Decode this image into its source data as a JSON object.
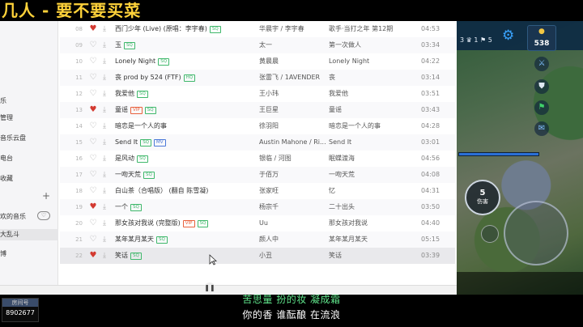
{
  "overlay": {
    "title": "几人 - 要不要买菜"
  },
  "sidebar": {
    "items": [
      {
        "label": "乐"
      },
      {
        "label": "管理"
      },
      {
        "label": "音乐云盘"
      },
      {
        "label": "电台"
      },
      {
        "label": "收藏"
      }
    ],
    "playlists_label": "欢的音乐",
    "active_label": "大乱斗",
    "bottom_label": "博",
    "plus_glyph": "+",
    "heart_glyph": "♡"
  },
  "songs": [
    {
      "idx": "08",
      "liked": true,
      "title": "西门少年 (Live) (原唱：李宇春)",
      "tags": [
        "SQ"
      ],
      "artist": "华晨宇 / 李宇春",
      "album": "歌手·当打之年 第12期",
      "time": "04:53"
    },
    {
      "idx": "09",
      "liked": false,
      "title": "玉",
      "tags": [
        "SQ"
      ],
      "artist": "太一",
      "album": "第一次做人",
      "time": "03:34"
    },
    {
      "idx": "10",
      "liked": false,
      "title": "Lonely Night",
      "tags": [
        "SQ"
      ],
      "artist": "黄晨晨",
      "album": "Lonely Night",
      "time": "04:22"
    },
    {
      "idx": "11",
      "liked": false,
      "title": "丧 prod by 524 (FTF)",
      "tags": [
        "HQ"
      ],
      "artist": "张雷飞 / 1AVENDER",
      "album": "丧",
      "time": "03:14"
    },
    {
      "idx": "12",
      "liked": false,
      "title": "我爱他",
      "tags": [
        "SQ"
      ],
      "artist": "王小玮",
      "album": "我爱他",
      "time": "03:51"
    },
    {
      "idx": "13",
      "liked": true,
      "title": "童谣",
      "tags": [
        "VIP",
        "SQ"
      ],
      "artist": "王巨星",
      "album": "童谣",
      "time": "03:43"
    },
    {
      "idx": "14",
      "liked": false,
      "title": "暗恋是一个人的事",
      "tags": [],
      "artist": "徐羽阳",
      "album": "暗恋是一个人的事",
      "time": "04:28"
    },
    {
      "idx": "15",
      "liked": false,
      "title": "Send It",
      "tags": [
        "SQ",
        "MV"
      ],
      "artist": "Austin Mahone / Ri...",
      "album": "Send It",
      "time": "03:01"
    },
    {
      "idx": "16",
      "liked": false,
      "title": "是风动",
      "tags": [
        "SQ"
      ],
      "artist": "银临 / 河图",
      "album": "眠蝶渡海",
      "time": "04:56"
    },
    {
      "idx": "17",
      "liked": false,
      "title": "一吻天荒",
      "tags": [
        "SQ"
      ],
      "artist": "于佰万",
      "album": "一吻天荒",
      "time": "04:08"
    },
    {
      "idx": "18",
      "liked": false,
      "title": "白山茶（合唱版） (翻自 陈雪凝)",
      "tags": [],
      "artist": "张家旺",
      "album": "忆",
      "time": "04:31"
    },
    {
      "idx": "19",
      "liked": true,
      "title": "一个",
      "tags": [
        "SQ"
      ],
      "artist": "杨宗千",
      "album": "二十出头",
      "time": "03:50"
    },
    {
      "idx": "20",
      "liked": false,
      "title": "那女孩对我说 (完整版)",
      "tags": [
        "VIP",
        "SQ"
      ],
      "artist": "Uu",
      "album": "那女孩对我说",
      "time": "04:40"
    },
    {
      "idx": "21",
      "liked": false,
      "title": "某年某月某天",
      "tags": [
        "SQ"
      ],
      "artist": "颜人中",
      "album": "某年某月某天",
      "time": "05:15"
    },
    {
      "idx": "22",
      "liked": true,
      "title": "笑话",
      "tags": [
        "SQ"
      ],
      "artist": "小丑",
      "album": "笑话",
      "time": "03:39"
    }
  ],
  "icons": {
    "heart_filled": "♥",
    "heart_empty": "♡",
    "download": "⤓",
    "pause": "❚❚",
    "gear": "⚙",
    "coin": "●"
  },
  "game": {
    "score": "3 ♛ 1 ⚑ 5",
    "gold": "538",
    "skill_count": "5",
    "skill_label": "伤害"
  },
  "stream": {
    "room_label": "房间号",
    "room_number": "8902677",
    "lyric_line_1": "苦思量 扮的妆 凝成霜",
    "lyric_line_2": "你的香 谁酝酿 在流浪"
  },
  "colors": {
    "title_yellow": "#ffd23a",
    "like_red": "#d33a31",
    "sq_green": "#3fb86b",
    "lyric_green": "#5fe38a",
    "game_blue": "#3aa4ff"
  }
}
